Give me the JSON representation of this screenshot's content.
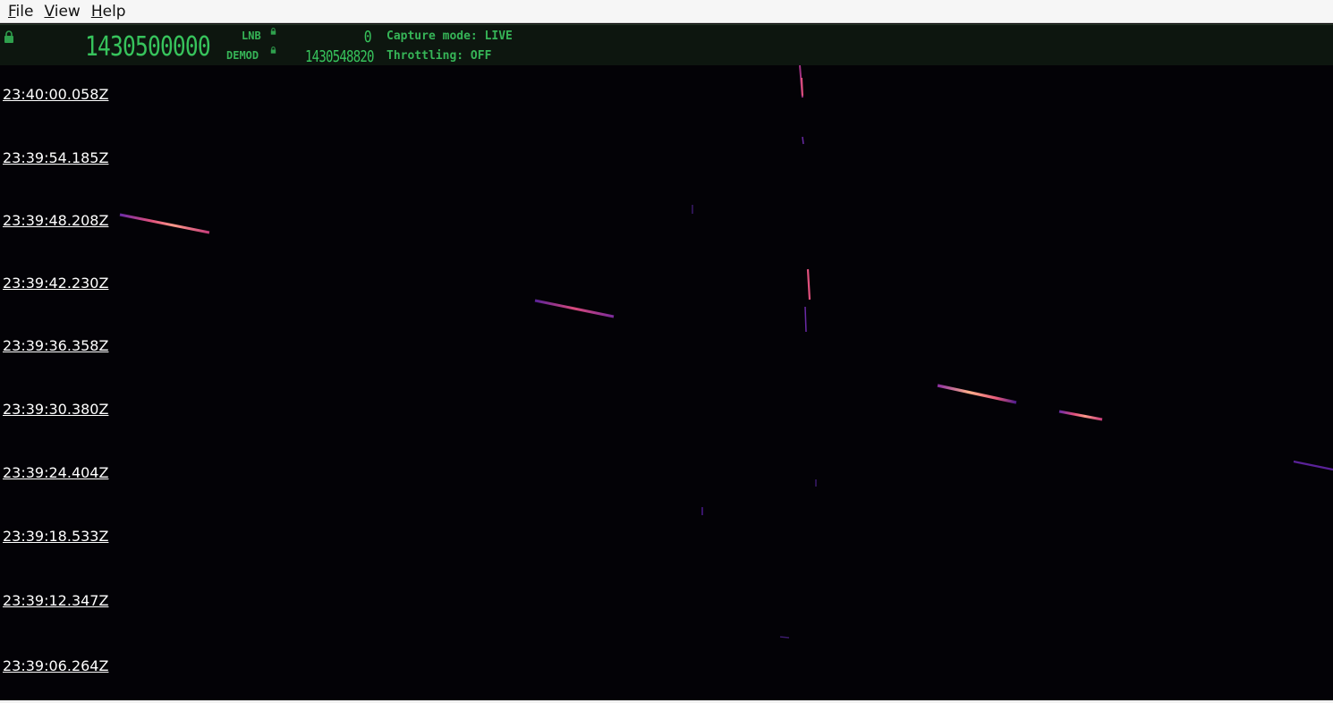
{
  "menu": {
    "file": {
      "mnemonic": "F",
      "rest": "ile"
    },
    "view": {
      "mnemonic": "V",
      "rest": "iew"
    },
    "help": {
      "mnemonic": "H",
      "rest": "elp"
    }
  },
  "status": {
    "frequency": "1430500000",
    "lnb_label": "LNB",
    "lnb_value": "0",
    "demod_label": "DEMOD",
    "demod_value": "1430548820",
    "capture_mode": "Capture mode: LIVE",
    "throttling": "Throttling: OFF",
    "colors": {
      "text_green": "#37c35c",
      "panel_bg": "#0d160f"
    }
  },
  "waterfall": {
    "timestamps": [
      "23:40:00.058Z",
      "23:39:54.185Z",
      "23:39:48.208Z",
      "23:39:42.230Z",
      "23:39:36.358Z",
      "23:39:30.380Z",
      "23:39:24.404Z",
      "23:39:18.533Z",
      "23:39:12.347Z",
      "23:39:06.264Z"
    ],
    "colormap": {
      "low": "#4b1a8c",
      "mid": "#d9437a",
      "high": "#ffb28a",
      "background": "#030206"
    }
  }
}
